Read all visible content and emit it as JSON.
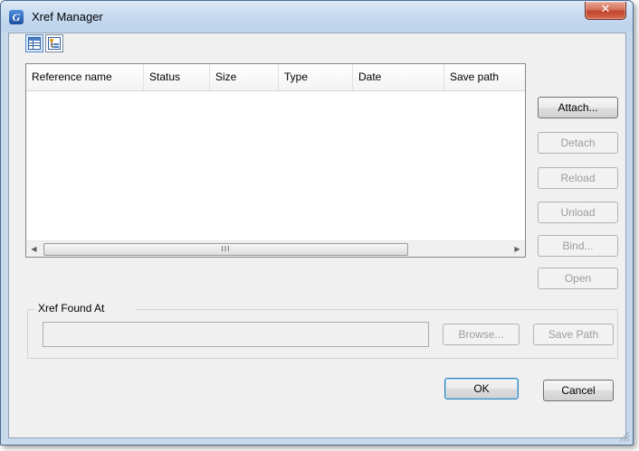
{
  "window": {
    "title": "Xref Manager",
    "app_icon_letter": "G",
    "close_glyph": "✕"
  },
  "toolbar": {
    "list_view_icon": "list-view-icon",
    "tree_view_icon": "tree-view-icon"
  },
  "table": {
    "columns": [
      "Reference name",
      "Status",
      "Size",
      "Type",
      "Date",
      "Save path"
    ],
    "rows": [],
    "scroll_thumb_glyph": "III"
  },
  "side_buttons": {
    "attach": "Attach...",
    "detach": "Detach",
    "reload": "Reload",
    "unload": "Unload",
    "bind": "Bind...",
    "open": "Open"
  },
  "found_at": {
    "label": "Xref Found At",
    "value": "",
    "browse": "Browse...",
    "save_path": "Save Path"
  },
  "footer": {
    "ok": "OK",
    "cancel": "Cancel"
  },
  "colors": {
    "title_bar": "#c5d9ef",
    "close_button": "#c1442b",
    "dialog_bg": "#f0f0f0",
    "default_button_border": "#3c7fb1"
  }
}
